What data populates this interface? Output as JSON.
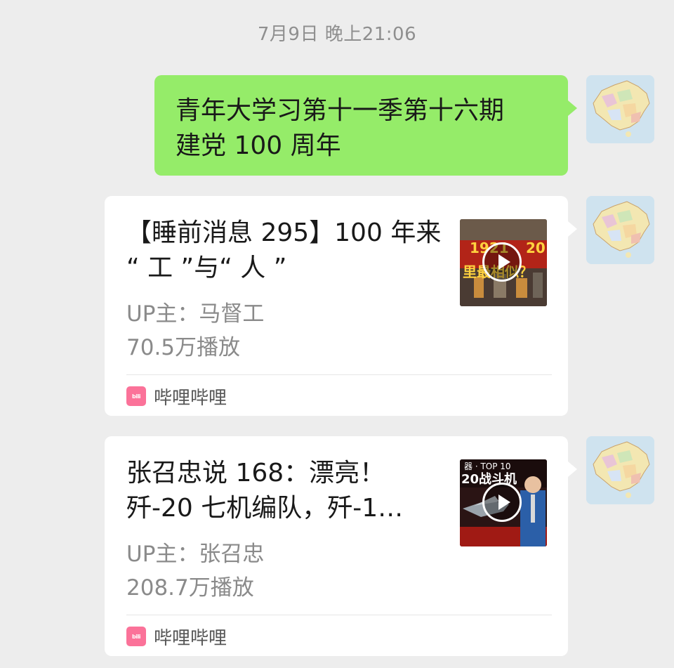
{
  "timestamp": "7月9日 晚上21:06",
  "message": {
    "lines": [
      "青年大学习第十一季第十六期",
      "建党 100 周年"
    ]
  },
  "cards": [
    {
      "title_lines": [
        "【睡前消息 295】100 年来",
        "“ 工 ”与“ 人 ”"
      ],
      "up": "UP主：马督工",
      "plays": "70.5万播放",
      "source": "哔哩哔哩",
      "thumb_text": [
        "1921",
        "20",
        "里最相似？"
      ]
    },
    {
      "title_lines": [
        "张召忠说 168：漂亮！",
        "歼-20 七机编队，歼-1…"
      ],
      "up": "UP主：张召忠",
      "plays": "208.7万播放",
      "source": "哔哩哔哩",
      "thumb_text": [
        "器 · TOP 10",
        "20战斗机"
      ]
    }
  ],
  "icons": {
    "avatar": "china-map-avatar-icon",
    "source": "bilibili-icon",
    "play": "play-icon"
  },
  "colors": {
    "background": "#ededed",
    "sent_bubble": "#95ec69",
    "card": "#ffffff",
    "bilibili_pink": "#fb7299"
  }
}
